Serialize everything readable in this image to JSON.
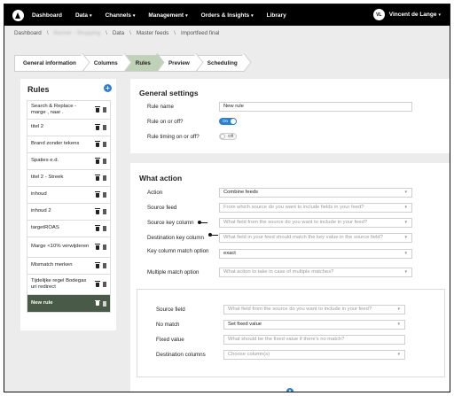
{
  "nav": {
    "logo_icon": "brand-logo-icon",
    "items": [
      {
        "label": "Dashboard",
        "caret": ""
      },
      {
        "label": "Data",
        "caret": "▾"
      },
      {
        "label": "Channels",
        "caret": "▾"
      },
      {
        "label": "Management",
        "caret": "▾"
      },
      {
        "label": "Orders & Insights",
        "caret": "▾"
      },
      {
        "label": "Library",
        "caret": ""
      }
    ],
    "user": {
      "initials": "VL",
      "name": "Vincent de Lange",
      "caret": "▾"
    }
  },
  "breadcrumb": {
    "items": [
      "Dashboard",
      "Banner - Shopping",
      "Data",
      "Master feeds",
      "Importfeed final"
    ],
    "separator": "\\"
  },
  "tabs": [
    "General information",
    "Columns",
    "Rules",
    "Preview",
    "Scheduling"
  ],
  "rules": {
    "title": "Rules",
    "add_icon": "plus-circle-icon",
    "items": [
      "Search & Replace - marge , naar .",
      "titel 2",
      "Brand zonder tekens",
      "Spaties e.d.",
      "titel 2 - Streek",
      "inhoud",
      "inhoud 2",
      "targetROAS",
      "Marge <10% verwijderen",
      "Mismatch merken",
      "Tijdelijke regel Bodegas uri redirect",
      "New rule"
    ],
    "active_index": 11
  },
  "general": {
    "title": "General settings",
    "rule_name_label": "Rule name",
    "rule_name_value": "New rule",
    "rule_on_label": "Rule on or off?",
    "rule_on_state": "On",
    "timing_label": "Rule timing on or off?",
    "timing_state": "Off"
  },
  "action": {
    "title": "What action",
    "rows": [
      {
        "label": "Action",
        "value": "Combine feeds",
        "placeholder": false
      },
      {
        "label": "Source feed",
        "value": "From which source do you want to include fields in your feed?",
        "placeholder": true
      },
      {
        "label": "Source key column",
        "value": "What field from the source do you want to include in your feed?",
        "placeholder": true,
        "key": true
      },
      {
        "label": "Destination key column",
        "value": "What field in your feed should match the key value in the source field?",
        "placeholder": true,
        "key": true
      },
      {
        "label": "Key column match option",
        "value": "exact",
        "placeholder": false
      },
      {
        "label": "Multiple match option",
        "value": "What action to take in case of multiple matches?",
        "placeholder": true
      }
    ],
    "sub": [
      {
        "label": "Source field",
        "value": "What field from the source do you want to include in your feed?",
        "placeholder": true,
        "select": true
      },
      {
        "label": "No match",
        "value": "Set fixed value",
        "placeholder": false,
        "select": true
      },
      {
        "label": "Fixed value",
        "value": "What should be the fixed value if there's no match?",
        "placeholder": true,
        "select": false
      },
      {
        "label": "Destination columns",
        "value": "Choose column(s)",
        "placeholder": true,
        "select": true
      }
    ],
    "scroll_icon": "arrow-up-circle-icon"
  },
  "colors": {
    "accent": "#2f7fcf",
    "active_tab": "#bfd1b6",
    "active_rule": "#4a5a48",
    "nav_bg": "#000000"
  }
}
